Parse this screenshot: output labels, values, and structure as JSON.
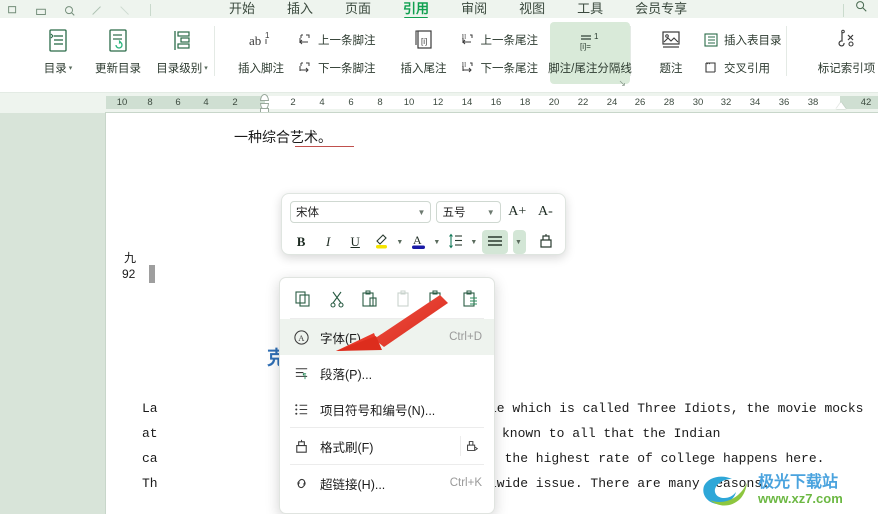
{
  "app": {
    "name": "WPS Writer",
    "accent": "#10a050",
    "ribbon_bg": "#ffffff",
    "tabbar_bg": "#eef4ee",
    "highlight_bg": "#d9ead9",
    "doc_bg": "#d8e4d9"
  },
  "tabs": [
    {
      "label": "开始",
      "active": false
    },
    {
      "label": "插入",
      "active": false
    },
    {
      "label": "页面",
      "active": false
    },
    {
      "label": "引用",
      "active": true
    },
    {
      "label": "审阅",
      "active": false
    },
    {
      "label": "视图",
      "active": false
    },
    {
      "label": "工具",
      "active": false
    },
    {
      "label": "会员专享",
      "active": false
    }
  ],
  "quick_access": [
    {
      "name": "undo-icon"
    },
    {
      "name": "print-icon"
    },
    {
      "name": "print-preview-icon"
    },
    {
      "name": "redo-arrow-icon"
    },
    {
      "name": "undo-arrow-icon"
    }
  ],
  "search_icon": "search-icon",
  "ribbon": {
    "groups": [
      {
        "id": "toc",
        "buttons": [
          {
            "label": "目录",
            "icon": "toc-icon",
            "caret": true
          },
          {
            "label": "更新目录",
            "icon": "update-toc-icon",
            "caret": false
          },
          {
            "label": "目录级别",
            "icon": "toc-level-icon",
            "caret": true
          }
        ]
      },
      {
        "id": "footnote",
        "buttons": [
          {
            "label": "插入脚注",
            "icon": "insert-footnote-icon",
            "caret": false
          }
        ],
        "stack": [
          {
            "label": "上一条脚注",
            "icon": "prev-footnote-icon"
          },
          {
            "label": "下一条脚注",
            "icon": "next-footnote-icon"
          }
        ]
      },
      {
        "id": "endnote",
        "buttons": [
          {
            "label": "插入尾注",
            "icon": "insert-endnote-icon",
            "caret": false
          }
        ],
        "stack": [
          {
            "label": "上一条尾注",
            "icon": "prev-endnote-icon"
          },
          {
            "label": "下一条尾注",
            "icon": "next-endnote-icon"
          }
        ],
        "highlighted": {
          "label": "脚注/尾注分隔线",
          "icon": "footnote-separator-icon"
        },
        "launcher": "dialog-launcher-icon"
      },
      {
        "id": "caption",
        "buttons": [
          {
            "label": "题注",
            "icon": "caption-icon",
            "caret": false
          }
        ],
        "stack": [
          {
            "label": "插入表目录",
            "icon": "insert-table-of-figures-icon"
          },
          {
            "label": "交叉引用",
            "icon": "cross-reference-icon"
          }
        ]
      },
      {
        "id": "index",
        "buttons": [
          {
            "label": "标记索引项",
            "icon": "mark-index-entry-icon",
            "caret": false
          }
        ]
      }
    ]
  },
  "ruler": {
    "left_numbers": [
      "10",
      "8",
      "6",
      "4",
      "2"
    ],
    "right_numbers": [
      "2",
      "4",
      "6",
      "8",
      "10",
      "12",
      "14",
      "16",
      "18",
      "20",
      "22",
      "24",
      "26",
      "28",
      "30",
      "32",
      "34",
      "36",
      "38"
    ],
    "far_right_number": "42",
    "markers": [
      "first-line-indent-marker",
      "hanging-indent-marker",
      "left-indent-marker",
      "right-indent-marker"
    ]
  },
  "document": {
    "line_cn": "一种综合艺术。",
    "line_cn_underlined": "综合艺术",
    "gutter_chinese": "九",
    "gutter_number": "92",
    "heading_partial": "克",
    "body_lines": [
      {
        "left": "La",
        "right": "ie which is called Three Idiots, the movie mocks"
      },
      {
        "left": "at",
        "right": "known to all that the Indian"
      },
      {
        "left": "ca",
        "right": ", the highest rate of college happens here."
      },
      {
        "left": "Th",
        "right": "lwide issue. There are many reasons."
      }
    ]
  },
  "minibar": {
    "font_name": "宋体",
    "font_size": "五号",
    "grow_font": "A+",
    "shrink_font": "A-",
    "bold": "B",
    "italic": "I",
    "underline": "U",
    "highlight_color_icon": "text-highlight-icon",
    "font_color_icon": "font-color-icon",
    "line_spacing_icon": "line-spacing-icon",
    "align_icon": "align-icon",
    "format_painter_icon": "format-painter-icon",
    "highlight_swatch": "#f5e400",
    "font_color_swatch": "#1a1aa6",
    "align_selected_bg": "#d3e6d6"
  },
  "context_menu": {
    "icon_row": [
      {
        "name": "copy-icon"
      },
      {
        "name": "cut-icon"
      },
      {
        "name": "paste-icon"
      },
      {
        "name": "paste-keep-source-icon"
      },
      {
        "name": "paste-text-only-icon"
      },
      {
        "name": "paste-merge-format-icon"
      }
    ],
    "items": [
      {
        "name": "font-menu-item",
        "icon": "font-circle-a-icon",
        "label": "字体(F)...",
        "shortcut": "Ctrl+D",
        "highlighted": true
      },
      {
        "name": "paragraph-menu-item",
        "icon": "paragraph-icon",
        "label": "段落(P)...",
        "shortcut": "",
        "highlighted": false
      },
      {
        "name": "bullets-numbering-menu-item",
        "icon": "bullets-numbering-icon",
        "label": "项目符号和编号(N)...",
        "shortcut": "",
        "highlighted": false
      },
      {
        "name": "format-painter-menu-item",
        "icon": "format-painter-icon",
        "label": "格式刷(F)",
        "shortcut": "",
        "side_icon": "format-painter-options-icon",
        "highlighted": false
      },
      {
        "name": "hyperlink-menu-item",
        "icon": "hyperlink-icon",
        "label": "超链接(H)...",
        "shortcut": "Ctrl+K",
        "highlighted": false
      }
    ]
  },
  "annotation": {
    "arrow_color": "#e8392a",
    "name": "red-pointer-arrow"
  },
  "watermark": {
    "title": "极光下载站",
    "url": "www.xz7.com"
  }
}
